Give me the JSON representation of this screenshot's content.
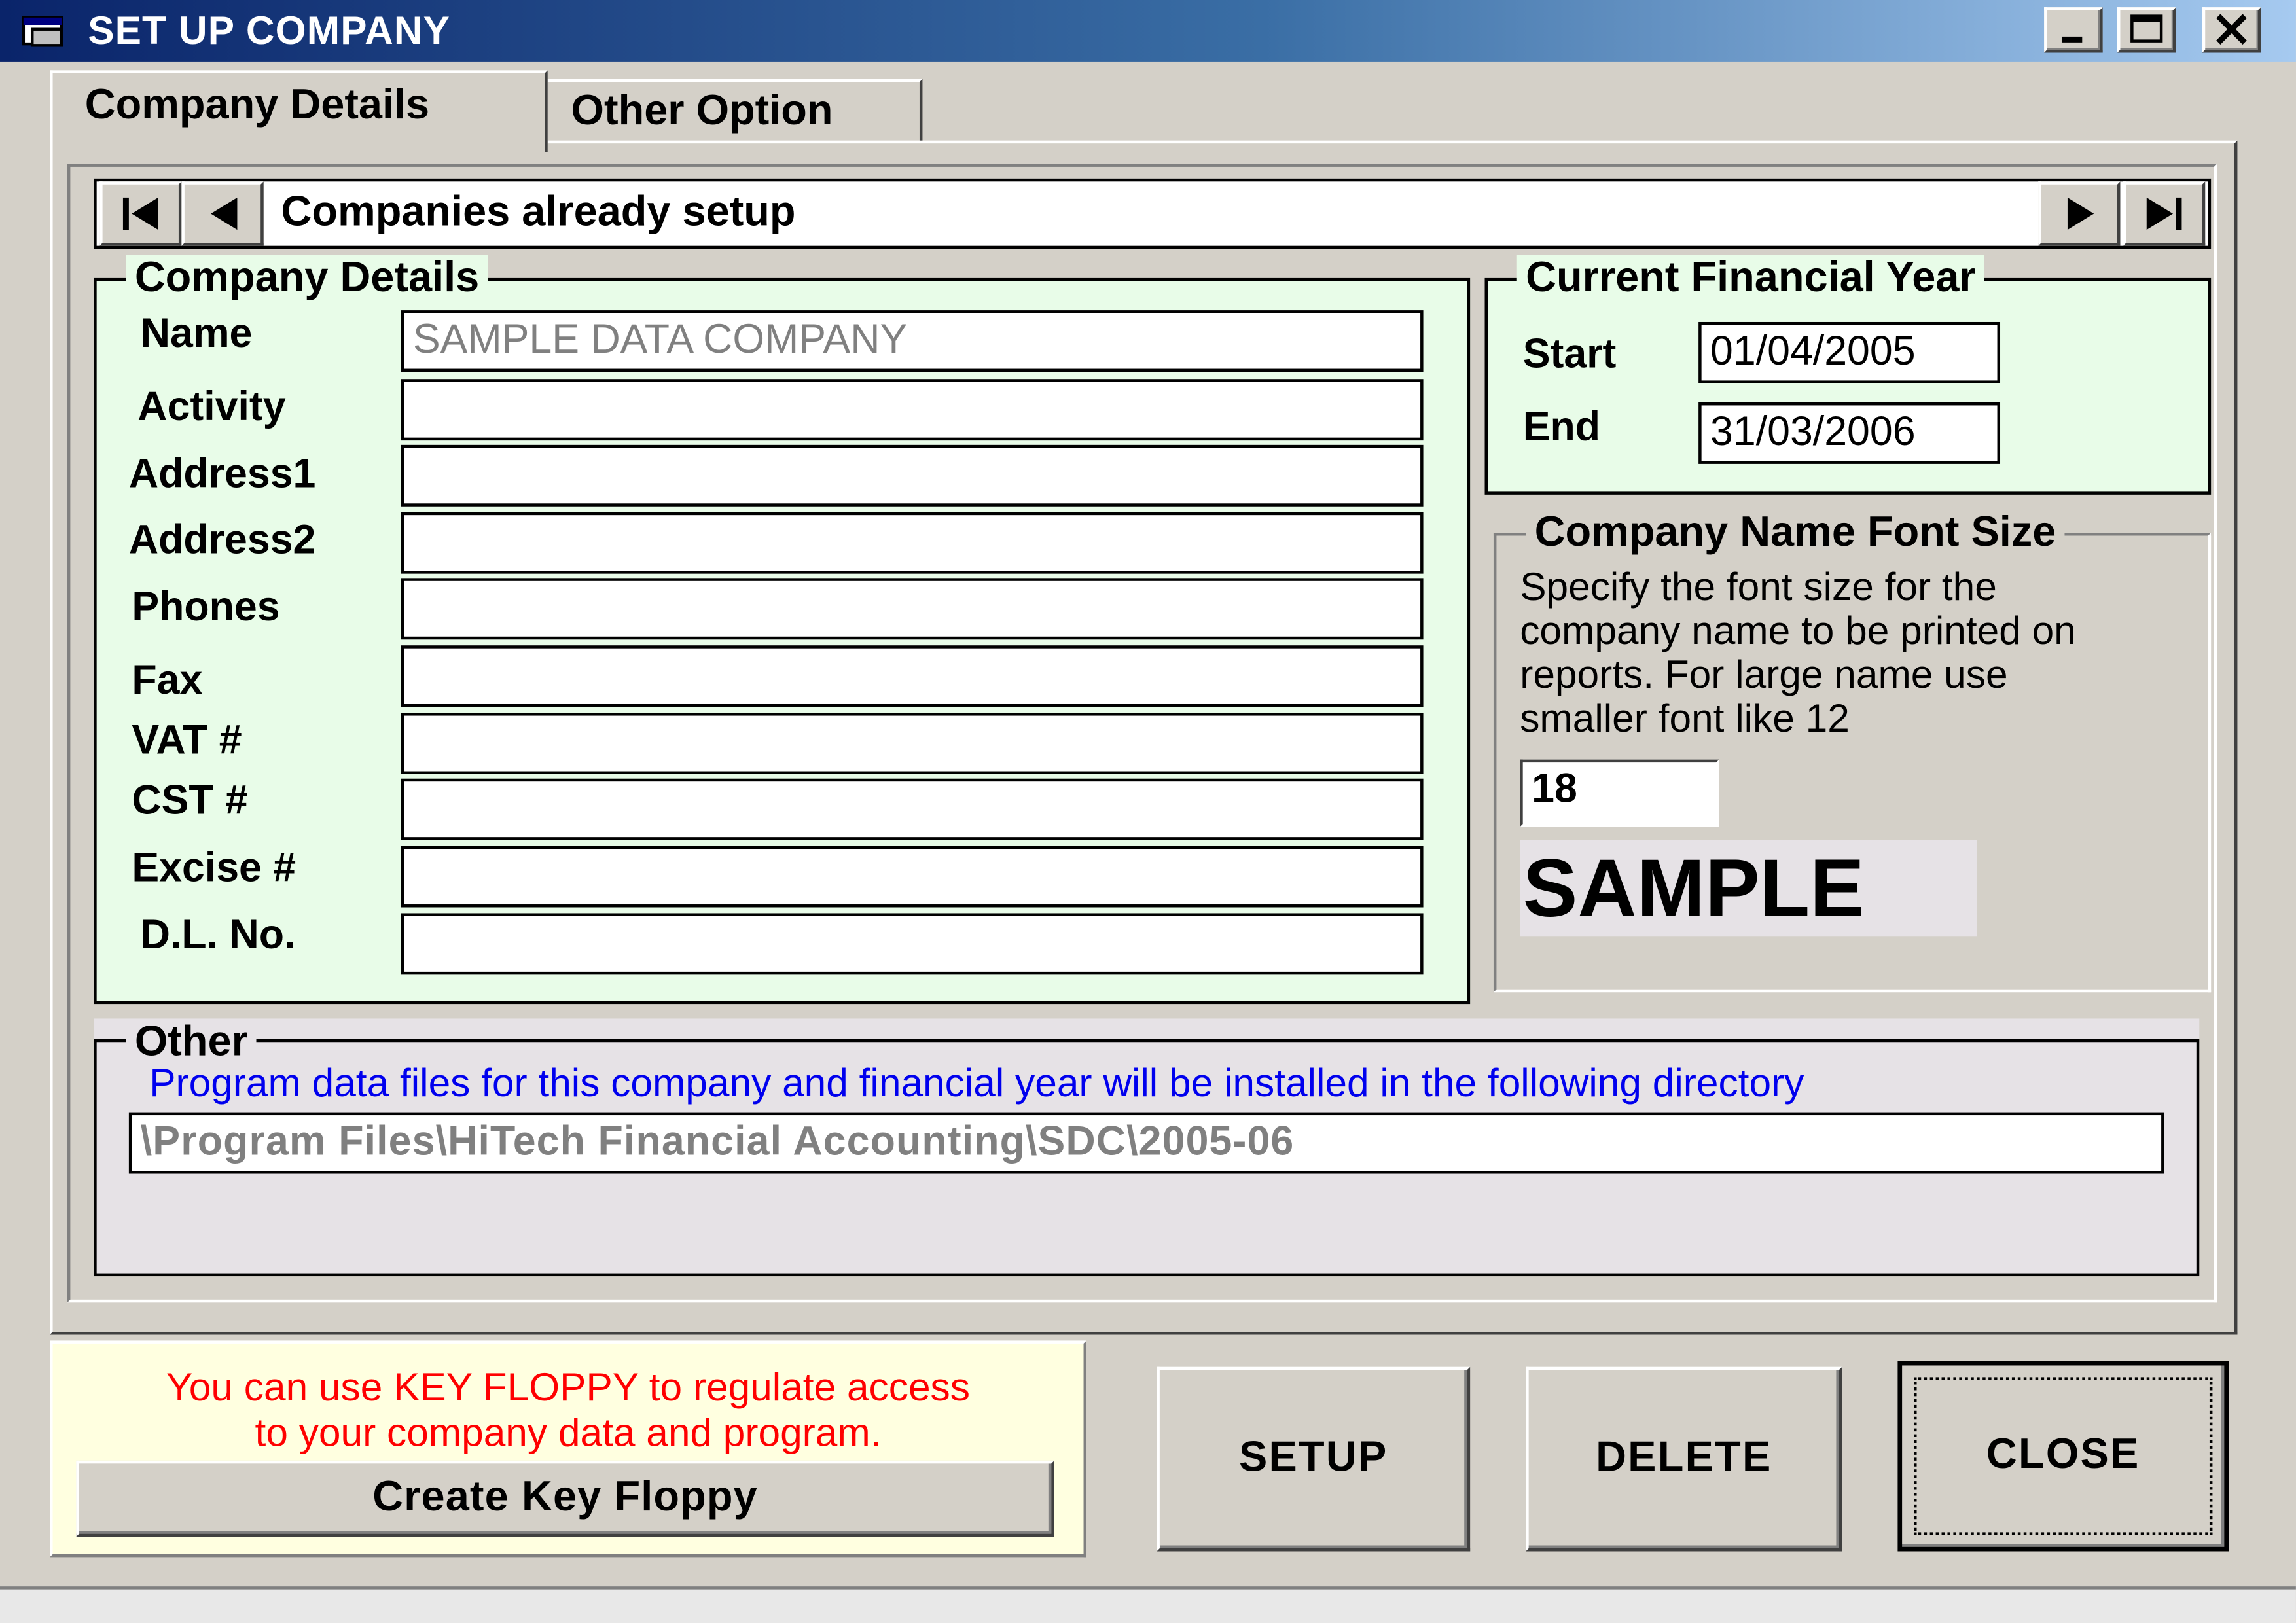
{
  "window": {
    "title": "SET UP COMPANY"
  },
  "tabs": [
    {
      "label": "Company Details",
      "selected": true
    },
    {
      "label": "Other Option",
      "selected": false
    }
  ],
  "navigator": {
    "caption": "Companies already setup"
  },
  "company_details": {
    "group_title": "Company Details",
    "fields": [
      {
        "label": "Name",
        "value": "SAMPLE DATA COMPANY"
      },
      {
        "label": "Activity",
        "value": ""
      },
      {
        "label": "Address1",
        "value": ""
      },
      {
        "label": "Address2",
        "value": ""
      },
      {
        "label": "Phones",
        "value": ""
      },
      {
        "label": "Fax",
        "value": ""
      },
      {
        "label": "VAT #",
        "value": ""
      },
      {
        "label": "CST #",
        "value": ""
      },
      {
        "label": "Excise #",
        "value": ""
      },
      {
        "label": "D.L. No.",
        "value": ""
      }
    ]
  },
  "financial_year": {
    "group_title": "Current Financial Year",
    "start_label": "Start",
    "start_value": "01/04/2005",
    "end_label": "End",
    "end_value": "31/03/2006"
  },
  "font_size": {
    "group_title": "Company Name Font Size",
    "description_lines": [
      "Specify the font size for the",
      "company name to be printed on",
      "reports. For large name use",
      "smaller font like 12"
    ],
    "value": "18",
    "sample_text": "SAMPLE"
  },
  "other": {
    "group_title": "Other",
    "note": "Program data files for this company and financial year will be installed in the following directory",
    "directory": "\\Program Files\\HiTech Financial Accounting\\SDC\\2005-06"
  },
  "key_floppy": {
    "message_lines": [
      "You can use KEY FLOPPY to regulate access",
      "to your company data and program."
    ],
    "button_label": "Create Key Floppy"
  },
  "actions": {
    "setup_label": "SETUP",
    "delete_label": "DELETE",
    "close_label": "CLOSE"
  },
  "colors": {
    "titlebar_start": "#0a246a",
    "titlebar_end": "#a6caf0",
    "group_background": "#e8fce8",
    "note_text": "#0000ee",
    "warning_text": "#ff0000",
    "key_floppy_background": "#ffffe0"
  }
}
